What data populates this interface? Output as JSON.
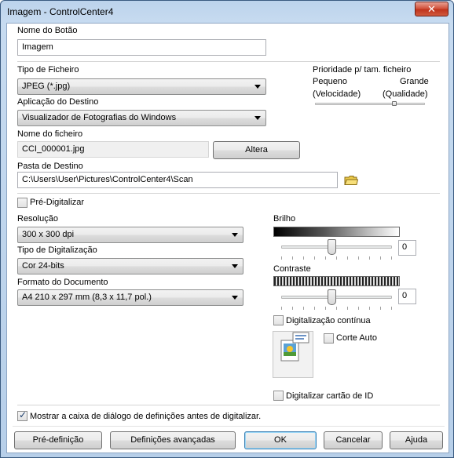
{
  "window": {
    "title": "Imagem - ControlCenter4",
    "close_glyph": "✕"
  },
  "button_name": {
    "label": "Nome do Botão",
    "value": "Imagem"
  },
  "file_type": {
    "label": "Tipo de Ficheiro",
    "value": "JPEG (*.jpg)"
  },
  "priority": {
    "label": "Prioridade p/ tam. ficheiro",
    "small": "Pequeno",
    "small_note": "(Velocidade)",
    "large": "Grande",
    "large_note": "(Qualidade)",
    "level": 0.72
  },
  "destination_app": {
    "label": "Aplicação do Destino",
    "value": "Visualizador de Fotografias do Windows"
  },
  "file_name": {
    "label": "Nome do ficheiro",
    "value": "CCI_000001.jpg",
    "change_button": "Altera"
  },
  "dest_folder": {
    "label": "Pasta de Destino",
    "value": "C:\\Users\\User\\Pictures\\ControlCenter4\\Scan",
    "icon": "folder-icon"
  },
  "prescan": {
    "label": "Pré-Digitalizar",
    "checked": false
  },
  "resolution": {
    "label": "Resolução",
    "value": "300 x 300 dpi"
  },
  "scan_type": {
    "label": "Tipo de Digitalização",
    "value": "Cor 24-bits"
  },
  "document_size": {
    "label": "Formato do Documento",
    "value": "A4 210 x 297 mm (8,3 x 11,7 pol.)"
  },
  "brightness": {
    "label": "Brilho",
    "value": "0"
  },
  "contrast": {
    "label": "Contraste",
    "value": "0"
  },
  "continuous_scan": {
    "label": "Digitalização contínua",
    "checked": false
  },
  "auto_crop": {
    "label": "Corte Auto",
    "checked": false,
    "icon": "auto-crop-illustration-icon"
  },
  "id_card_scan": {
    "label": "Digitalizar cartão de ID",
    "checked": false
  },
  "show_dialog": {
    "label": "Mostrar a caixa de diálogo de definições antes de digitalizar.",
    "checked": true
  },
  "buttons": {
    "preset": "Pré-definição",
    "advanced": "Definições avançadas",
    "ok": "OK",
    "cancel": "Cancelar",
    "help": "Ajuda"
  }
}
